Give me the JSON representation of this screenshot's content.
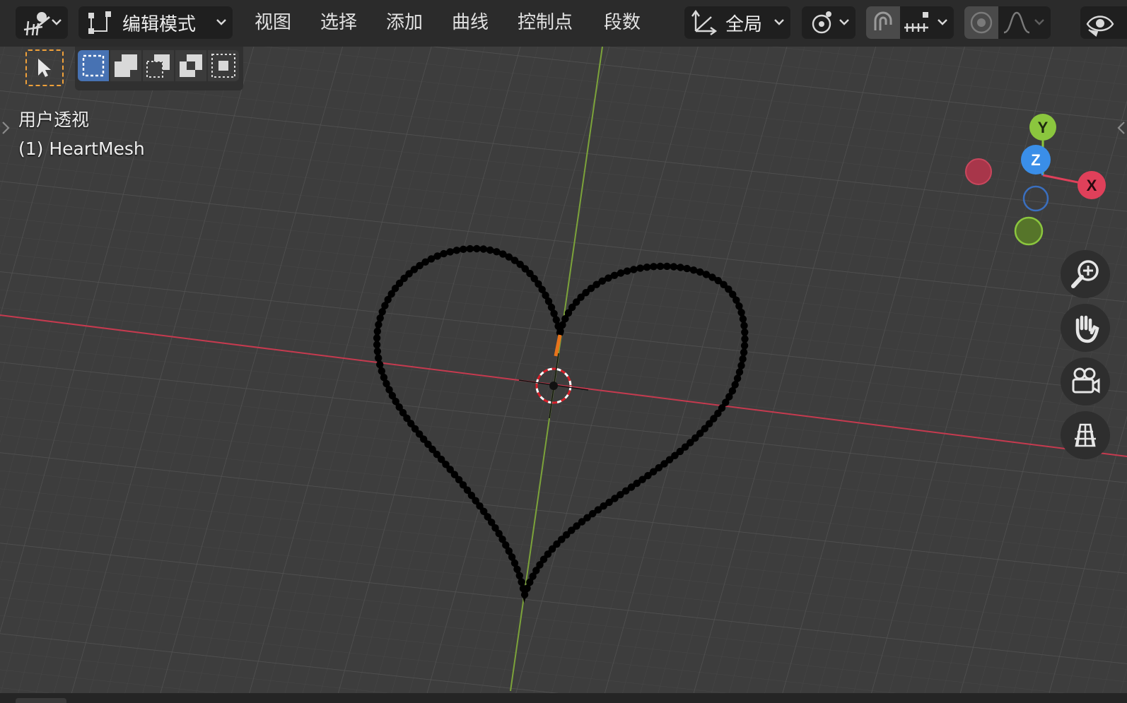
{
  "header": {
    "mode_label": "编辑模式",
    "menus": {
      "view": "视图",
      "select": "选择",
      "add": "添加",
      "curve": "曲线",
      "control_points": "控制点",
      "segments": "段数"
    },
    "orientation_label": "全局"
  },
  "overlay": {
    "view_name": "用户透视",
    "object_name": "(1) HeartMesh"
  },
  "gizmo": {
    "y_label": "Y",
    "z_label": "Z",
    "x_label": "X"
  },
  "colors": {
    "accent_select": "#4772b3",
    "active_tool_border": "#f0a13a",
    "axis_x": "#e0405a",
    "axis_y": "#8bc63e",
    "axis_z": "#3a8ee8",
    "grid_bg": "#3d3d3d",
    "heart_vertex": "#000000",
    "header_bg": "#2b2b2b"
  },
  "icons": {
    "editor_type": "editor-type-icon",
    "mode": "edit-mode-icon",
    "orientation": "transform-orientation-icon",
    "pivot": "pivot-point-icon",
    "snap": "snap-magnet-icon",
    "snap_increment": "snap-increment-icon",
    "proportional": "proportional-edit-icon",
    "falloff": "falloff-curve-icon",
    "visibility": "visibility-eye-icon",
    "zoom": "zoom-icon",
    "pan": "hand-pan-icon",
    "camera": "camera-view-icon",
    "perspective": "perspective-grid-icon"
  }
}
